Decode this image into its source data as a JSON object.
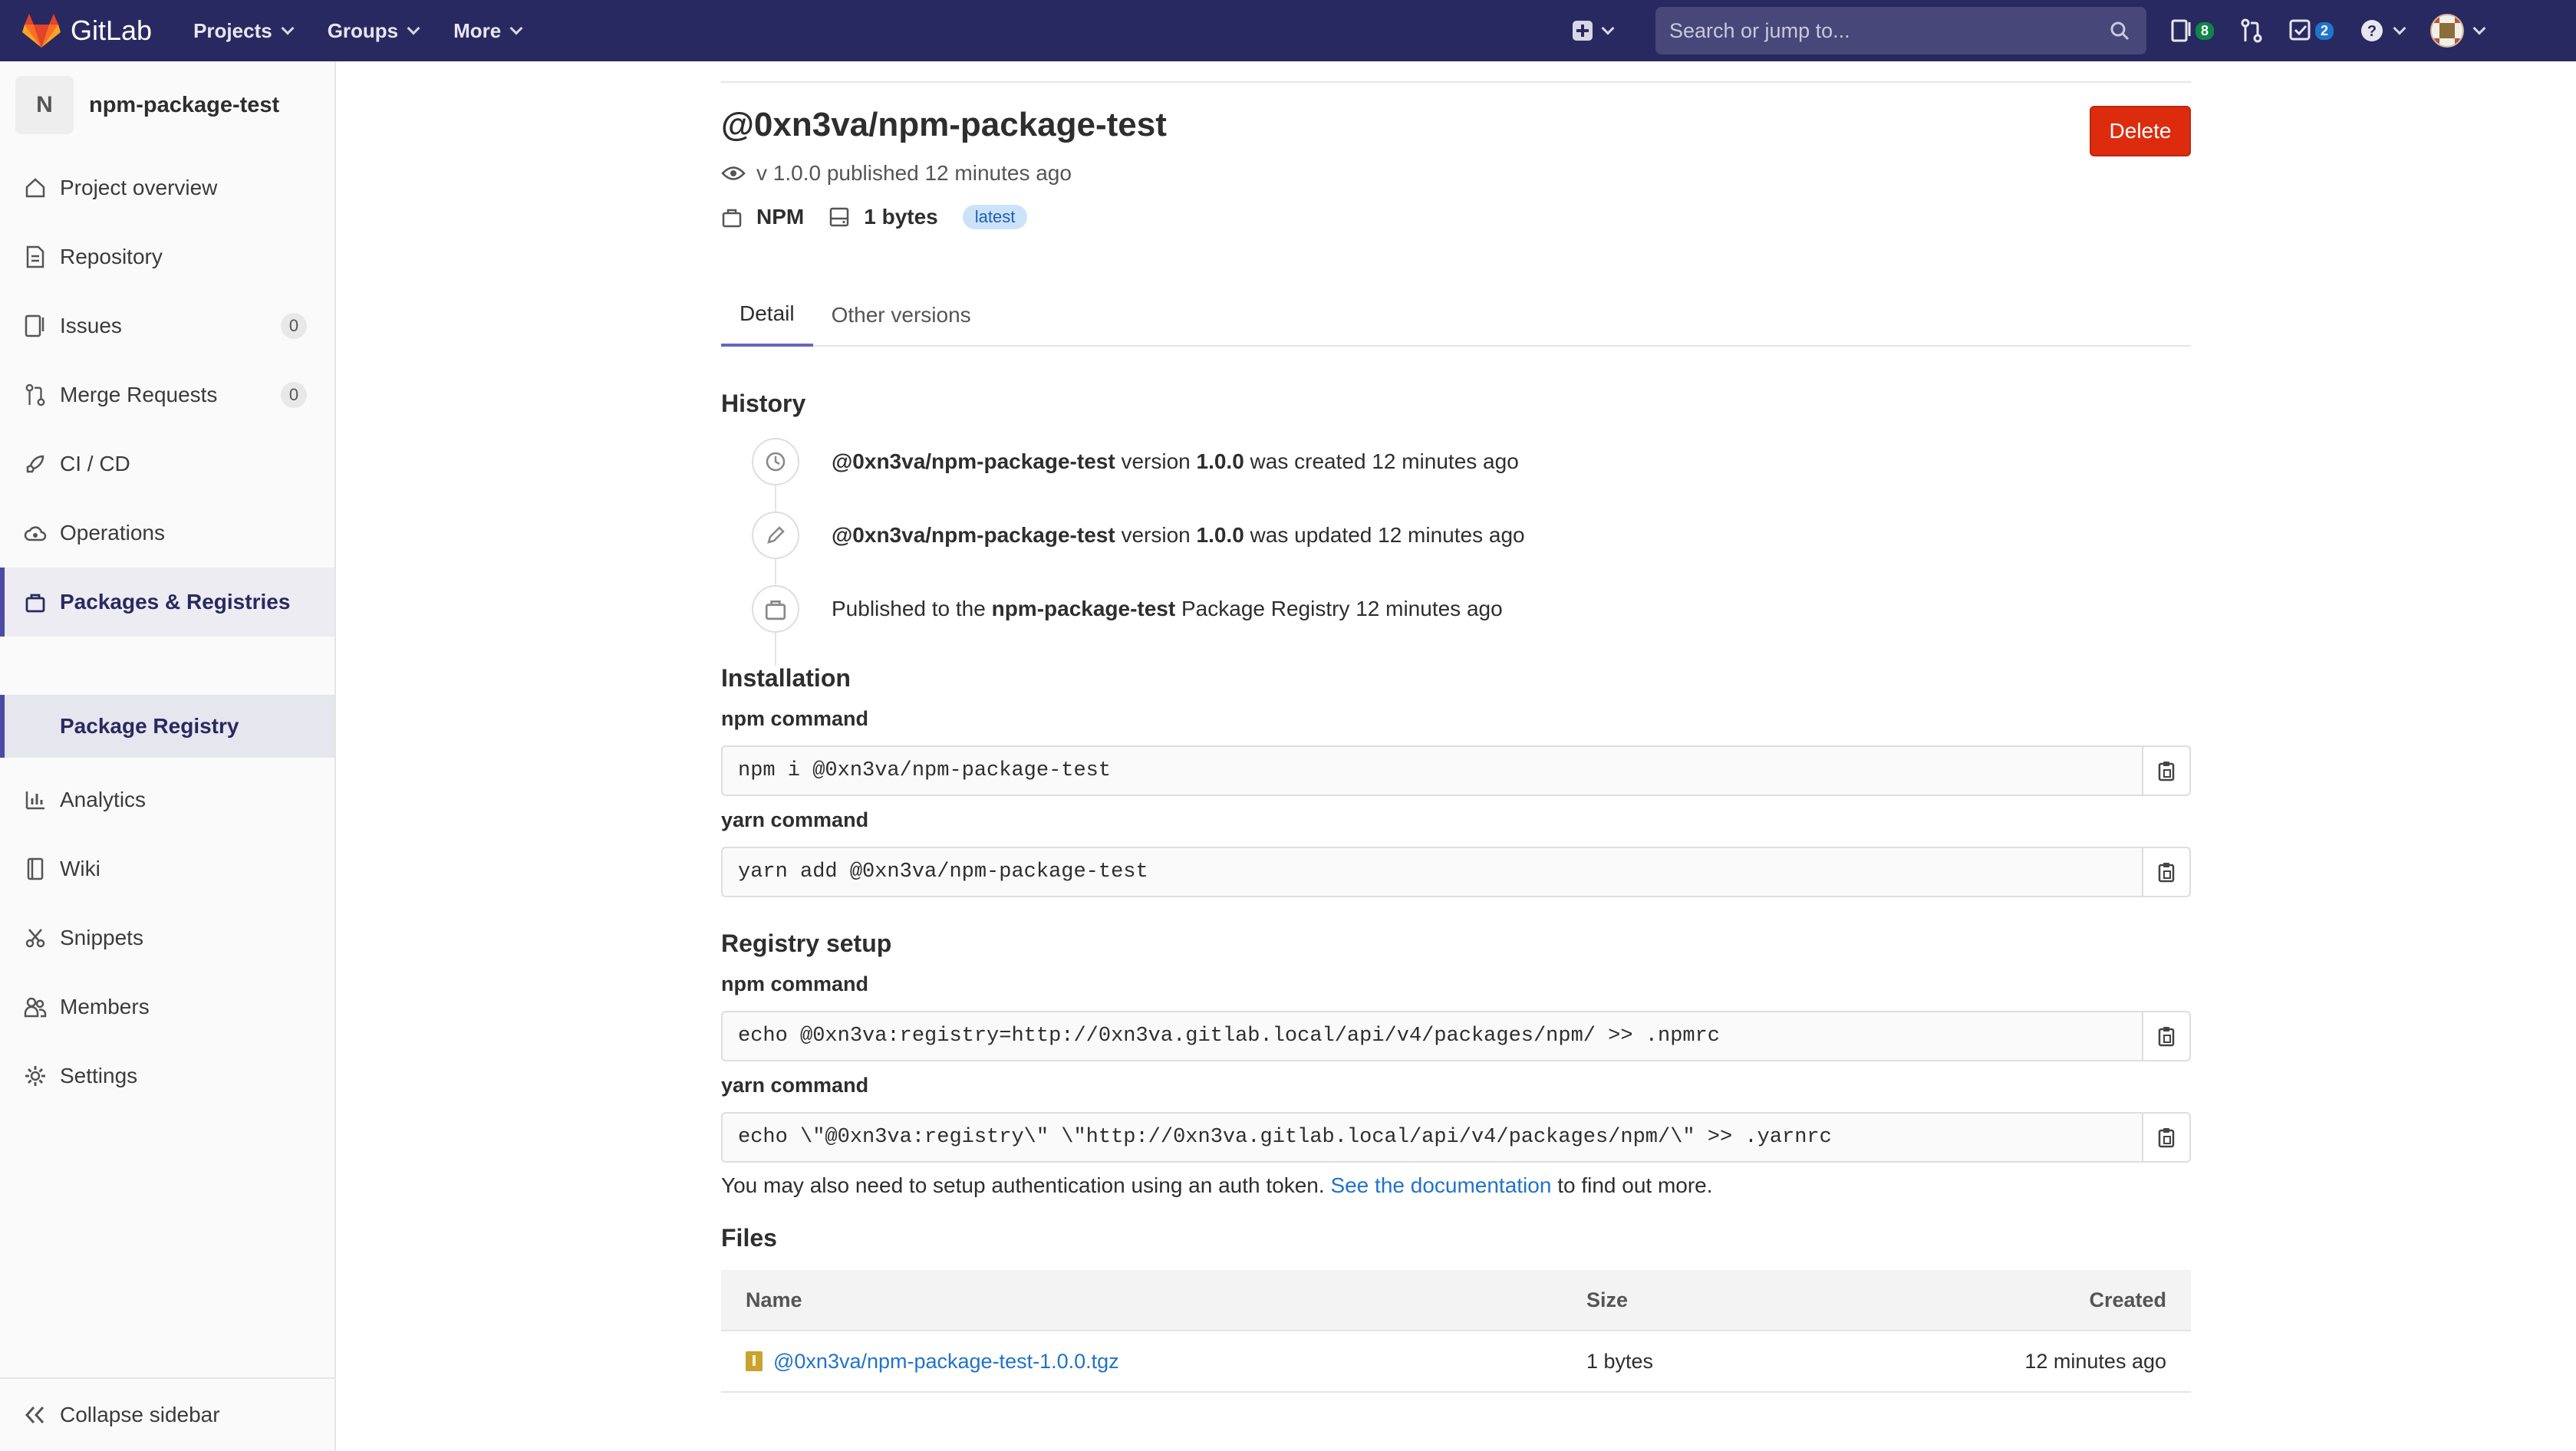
{
  "navbar": {
    "brand": "GitLab",
    "menu": [
      "Projects",
      "Groups",
      "More"
    ],
    "search_placeholder": "Search or jump to...",
    "issues_count": "8",
    "todos_count": "2",
    "colors": {
      "bg": "#292961",
      "issues_badge": "#108548",
      "todos_badge": "#1f75cb"
    }
  },
  "sidebar": {
    "project_initial": "N",
    "project_name": "npm-package-test",
    "items": [
      {
        "label": "Project overview",
        "icon": "home-icon"
      },
      {
        "label": "Repository",
        "icon": "document-icon"
      },
      {
        "label": "Issues",
        "icon": "issues-icon",
        "count": "0"
      },
      {
        "label": "Merge Requests",
        "icon": "merge-request-icon",
        "count": "0"
      },
      {
        "label": "CI / CD",
        "icon": "rocket-icon"
      },
      {
        "label": "Operations",
        "icon": "cloud-gear-icon"
      },
      {
        "label": "Packages & Registries",
        "icon": "package-icon"
      },
      {
        "label": "Package Registry",
        "icon": ""
      },
      {
        "label": "Analytics",
        "icon": "chart-icon"
      },
      {
        "label": "Wiki",
        "icon": "book-icon"
      },
      {
        "label": "Snippets",
        "icon": "scissors-icon"
      },
      {
        "label": "Members",
        "icon": "users-icon"
      },
      {
        "label": "Settings",
        "icon": "gear-icon"
      }
    ],
    "collapse_label": "Collapse sidebar"
  },
  "package": {
    "title": "@0xn3va/npm-package-test",
    "delete_label": "Delete",
    "published": "v 1.0.0 published 12 minutes ago",
    "type": "NPM",
    "size": "1 bytes",
    "tag": "latest"
  },
  "tabs": [
    "Detail",
    "Other versions"
  ],
  "history": {
    "heading": "History",
    "events": [
      {
        "name": "@0xn3va/npm-package-test",
        "mid": " version ",
        "version": "1.0.0",
        "tail": " was created 12 minutes ago"
      },
      {
        "name": "@0xn3va/npm-package-test",
        "mid": " version ",
        "version": "1.0.0",
        "tail": " was updated 12 minutes ago"
      }
    ],
    "published": {
      "pre": "Published to the ",
      "project": "npm-package-test",
      "tail": " Package Registry 12 minutes ago"
    }
  },
  "installation": {
    "heading": "Installation",
    "npm_label": "npm command",
    "npm_cmd": "npm i @0xn3va/npm-package-test",
    "yarn_label": "yarn command",
    "yarn_cmd": "yarn add @0xn3va/npm-package-test"
  },
  "registry": {
    "heading": "Registry setup",
    "npm_label": "npm command",
    "npm_cmd": "echo @0xn3va:registry=http://0xn3va.gitlab.local/api/v4/packages/npm/ >> .npmrc",
    "yarn_label": "yarn command",
    "yarn_cmd": "echo \\\"@0xn3va:registry\\\" \\\"http://0xn3va.gitlab.local/api/v4/packages/npm/\\\" >> .yarnrc",
    "note_pre": "You may also need to setup authentication using an auth token. ",
    "note_link": "See the documentation",
    "note_post": " to find out more."
  },
  "files": {
    "heading": "Files",
    "columns": [
      "Name",
      "Size",
      "Created"
    ],
    "rows": [
      {
        "name": "@0xn3va/npm-package-test-1.0.0.tgz",
        "size": "1 bytes",
        "created": "12 minutes ago"
      }
    ]
  }
}
